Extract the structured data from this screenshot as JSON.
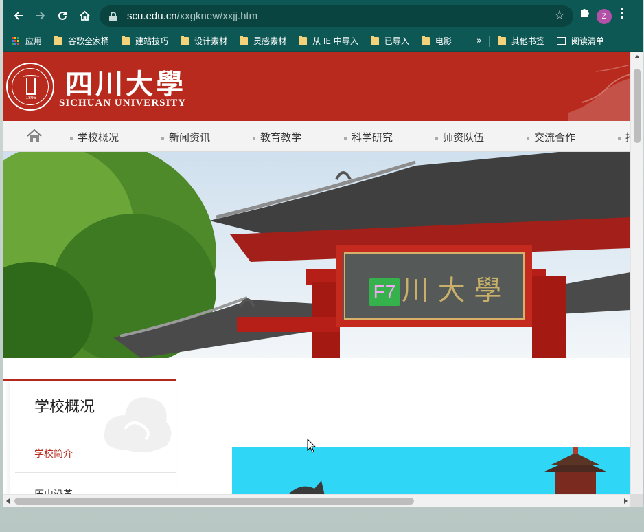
{
  "browser": {
    "url_host": "scu.edu.cn",
    "url_path": "/xxgknew/xxjj.htm",
    "profile_initial": "Z",
    "bookmarks": [
      "应用",
      "谷歌全家桶",
      "建站技巧",
      "设计素材",
      "灵感素材",
      "从 IE 中导入",
      "已导入",
      "电影"
    ],
    "bookmarks_right": [
      "其他书签",
      "阅读清单"
    ],
    "overflow_glyph": "»"
  },
  "site": {
    "logo_cn": "四川大學",
    "logo_en": "SICHUAN UNIVERSITY",
    "seal_year": "1896",
    "nav": [
      "学校概况",
      "新闻资讯",
      "教育教学",
      "科学研究",
      "师资队伍",
      "交流合作",
      "招"
    ]
  },
  "overlay": {
    "key_badge": "F7"
  },
  "sidebar": {
    "title": "学校概况",
    "items": [
      "学校简介",
      "历史沿革"
    ]
  },
  "colors": {
    "chrome": "#0d5754",
    "brand_red": "#b82a1d",
    "active_link": "#b82a1d",
    "banner_sky": "#2fd6f6"
  },
  "icons": {
    "back": "arrow-left-icon",
    "forward": "arrow-right-icon",
    "reload": "reload-icon",
    "home": "home-icon",
    "secure": "lock-icon",
    "bookmark": "star-icon",
    "extensions": "puzzle-icon",
    "menu": "kebab-icon",
    "nav_home": "house-icon"
  }
}
